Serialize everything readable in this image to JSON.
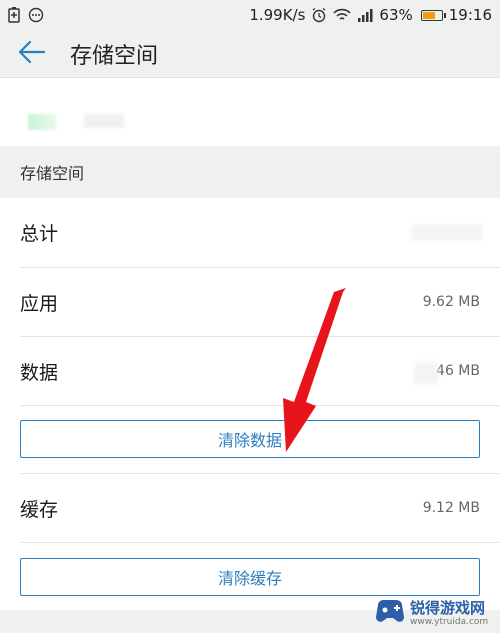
{
  "statusbar": {
    "network_speed": "1.99K/s",
    "battery_percent": "63%",
    "time": "19:16"
  },
  "appbar": {
    "title": "存储空间"
  },
  "section": {
    "header": "存储空间"
  },
  "rows": {
    "total": {
      "label": "总计",
      "value": ""
    },
    "apps": {
      "label": "应用",
      "value": "9.62 MB"
    },
    "data": {
      "label": "数据",
      "value": "46 MB"
    },
    "cache": {
      "label": "缓存",
      "value": "9.12 MB"
    }
  },
  "buttons": {
    "clear_data": "清除数据",
    "clear_cache": "清除缓存"
  },
  "watermark": {
    "name": "锐得游戏网",
    "url": "www.ytruida.com"
  },
  "colors": {
    "accent": "#2a7fc0",
    "arrow": "#e8141b",
    "header_bg": "#eef1ee"
  }
}
